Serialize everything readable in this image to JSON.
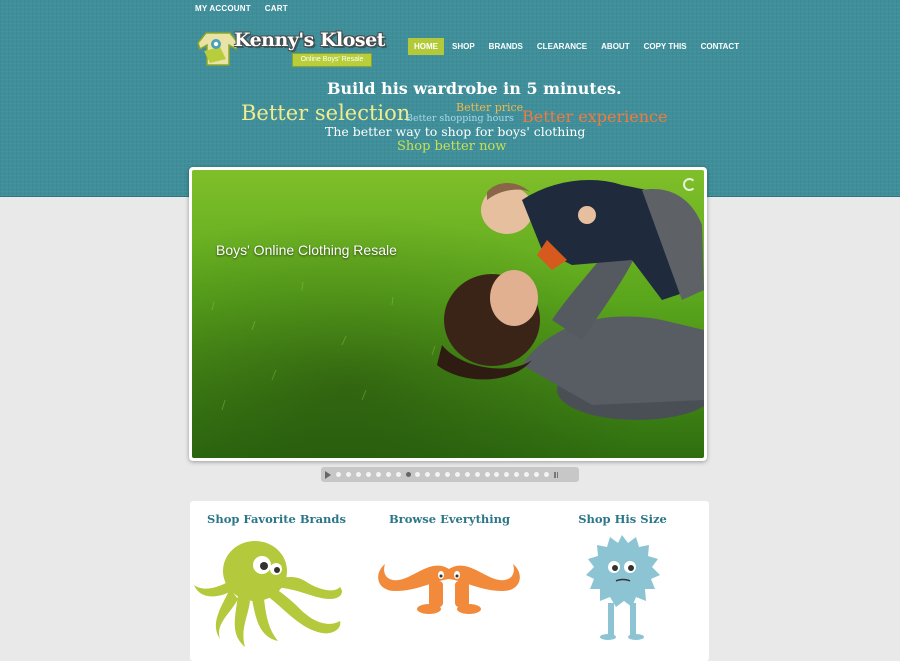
{
  "top_links": [
    "MY ACCOUNT",
    "CART"
  ],
  "logo": {
    "name": "Kenny's Kloset",
    "tagline": "Online Boys' Resale"
  },
  "nav": [
    {
      "label": "HOME",
      "active": true
    },
    {
      "label": "SHOP",
      "active": false
    },
    {
      "label": "BRANDS",
      "active": false
    },
    {
      "label": "CLEARANCE",
      "active": false
    },
    {
      "label": "ABOUT",
      "active": false
    },
    {
      "label": "COPY THIS",
      "active": false
    },
    {
      "label": "CONTACT",
      "active": false
    }
  ],
  "hero": {
    "headline": "Build his wardrobe in 5 minutes.",
    "better_selection": "Better selection",
    "better_price": "Better price",
    "better_hours": "Better shopping hours",
    "better_experience": "Better experience",
    "better_way": "The better way to shop for boys' clothing",
    "shop_better": "Shop better now"
  },
  "slider": {
    "caption": "Boys' Online Clothing Resale",
    "total_slides": 22,
    "active_index": 7
  },
  "categories": [
    {
      "title": "Shop Favorite Brands",
      "icon": "octopus-icon"
    },
    {
      "title": "Browse Everything",
      "icon": "mustache-icon"
    },
    {
      "title": "Shop His Size",
      "icon": "furry-monster-icon"
    }
  ],
  "colors": {
    "header_teal": "#3f8f9b",
    "accent_green": "#b2c93a",
    "heading_blue": "#2b7789",
    "orange": "#f07b3f",
    "monster_blue": "#8cc4d3",
    "octopus_green": "#b4c93b"
  }
}
